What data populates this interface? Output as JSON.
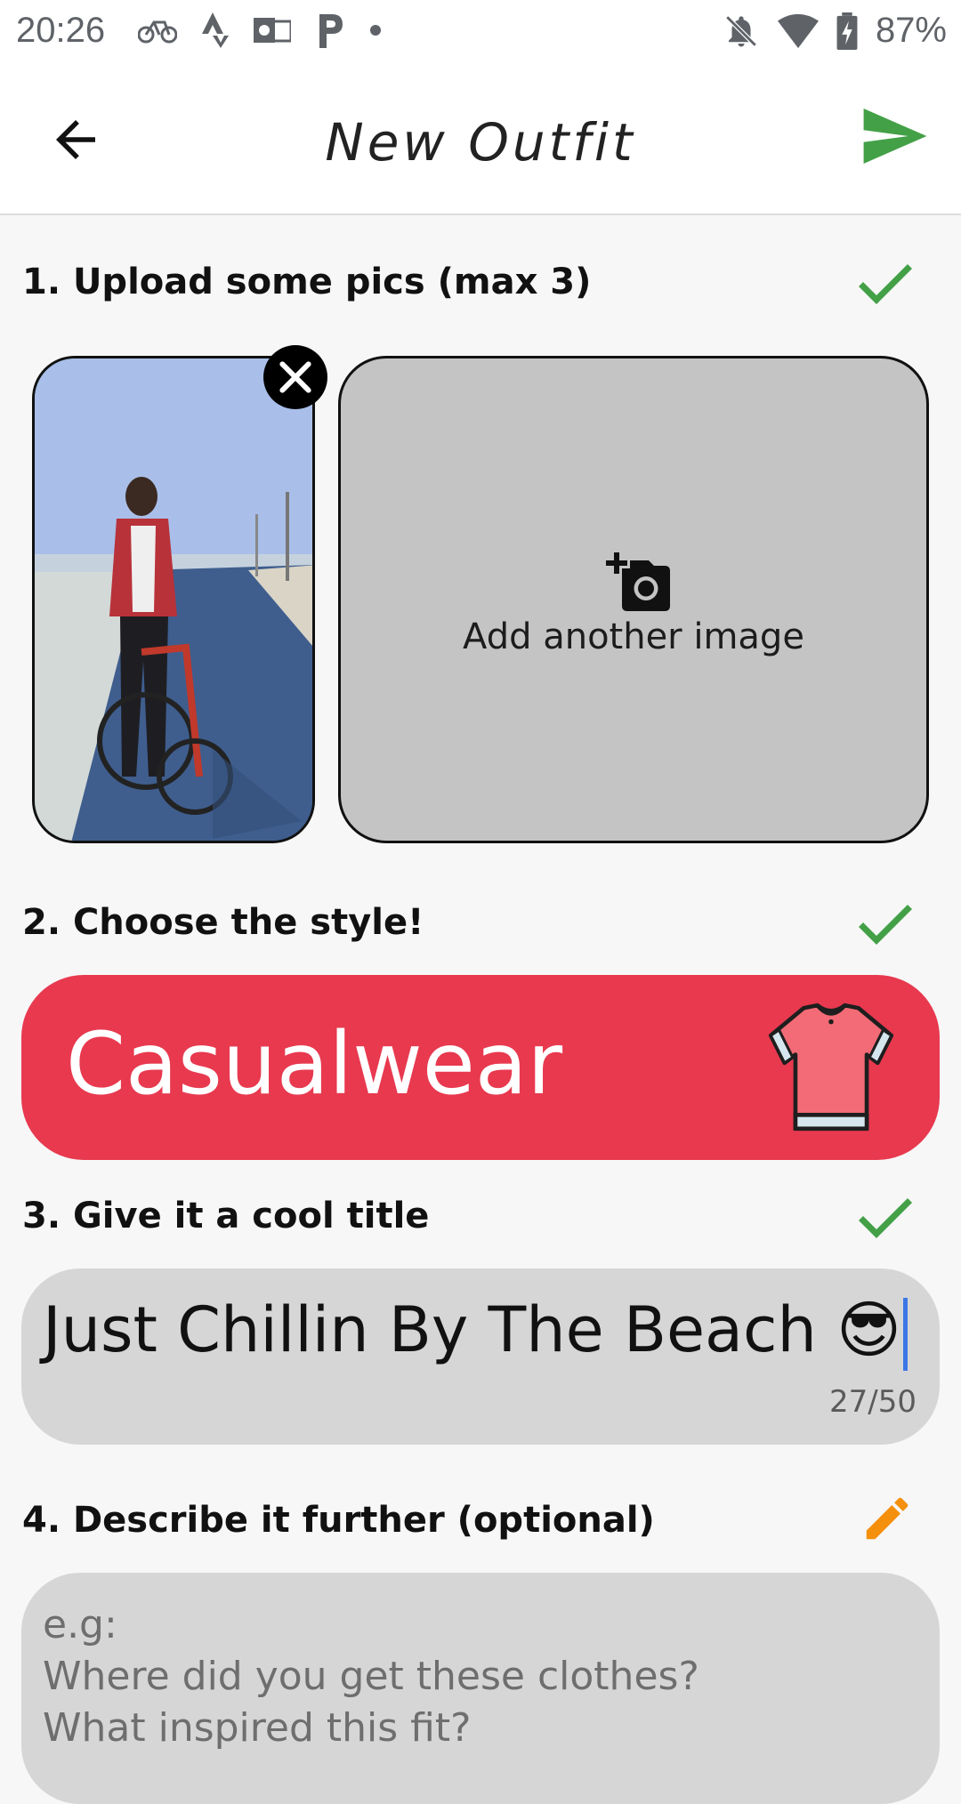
{
  "status_bar": {
    "time": "20:26",
    "battery": "87%",
    "left_icons": [
      "bike-icon",
      "strava-icon",
      "outlook-icon",
      "parking-icon",
      "dot-icon"
    ],
    "right_icons": [
      "notifications-off-icon",
      "wifi-icon",
      "battery-charging-icon"
    ]
  },
  "app_bar": {
    "title": "New Outfit",
    "back_icon": "arrow-back-icon",
    "send_icon": "send-icon",
    "send_color": "#43a047"
  },
  "steps": {
    "upload": {
      "label": "1. Upload some pics (max 3)",
      "status_icon": "check-icon"
    },
    "style": {
      "label": "2. Choose the style!",
      "status_icon": "check-icon"
    },
    "title": {
      "label": "3. Give it a cool title",
      "status_icon": "check-icon"
    },
    "describe": {
      "label": "4. Describe it further (optional)",
      "status_icon": "pencil-icon"
    }
  },
  "upload": {
    "add_label": "Add another image",
    "add_icon": "add-photo-icon",
    "remove_icon": "close-icon"
  },
  "style": {
    "selected": "Casualwear",
    "icon": "tshirt-icon",
    "color": "#e8394f"
  },
  "title_input": {
    "value": "Just Chillin By The Beach 😎",
    "counter": "27/50"
  },
  "description_input": {
    "placeholder": "e.g:\nWhere did you get these clothes?\nWhat inspired this fit?"
  },
  "colors": {
    "check": "#43a047",
    "pencil": "#f4900c"
  }
}
